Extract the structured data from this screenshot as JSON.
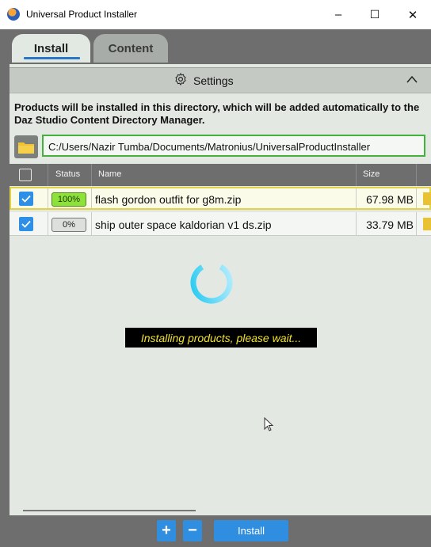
{
  "window": {
    "title": "Universal Product Installer",
    "minimize": "–",
    "maximize": "☐",
    "close": "✕"
  },
  "tabs": [
    {
      "label": "Install",
      "active": true
    },
    {
      "label": "Content",
      "active": false
    }
  ],
  "settings": {
    "label": "Settings",
    "icon": "gear-icon",
    "collapse_icon": "chevron-up-icon"
  },
  "info_text": "Products will be installed in this directory, which will be added automatically to the Daz Studio Content Directory Manager.",
  "install_path": "C:/Users/Nazir Tumba/Documents/Matronius/UniversalProductInstaller",
  "table": {
    "columns": [
      "Status",
      "Name",
      "Size"
    ],
    "rows": [
      {
        "checked": true,
        "status": "100%",
        "name": "flash gordon outfit for g8m.zip",
        "size": "67.98 MB"
      },
      {
        "checked": true,
        "status": "0%",
        "name": "ship outer space kaldorian v1 ds.zip",
        "size": "33.79 MB"
      }
    ]
  },
  "progress_message": "Installing products, please wait...",
  "footer": {
    "add_label": "+",
    "remove_label": "−",
    "install_label": "Install"
  },
  "colors": {
    "accent": "#2f8ee0",
    "path_border": "#44b13c",
    "status_complete": "#8ee03a",
    "message_text": "#f0e22a"
  }
}
